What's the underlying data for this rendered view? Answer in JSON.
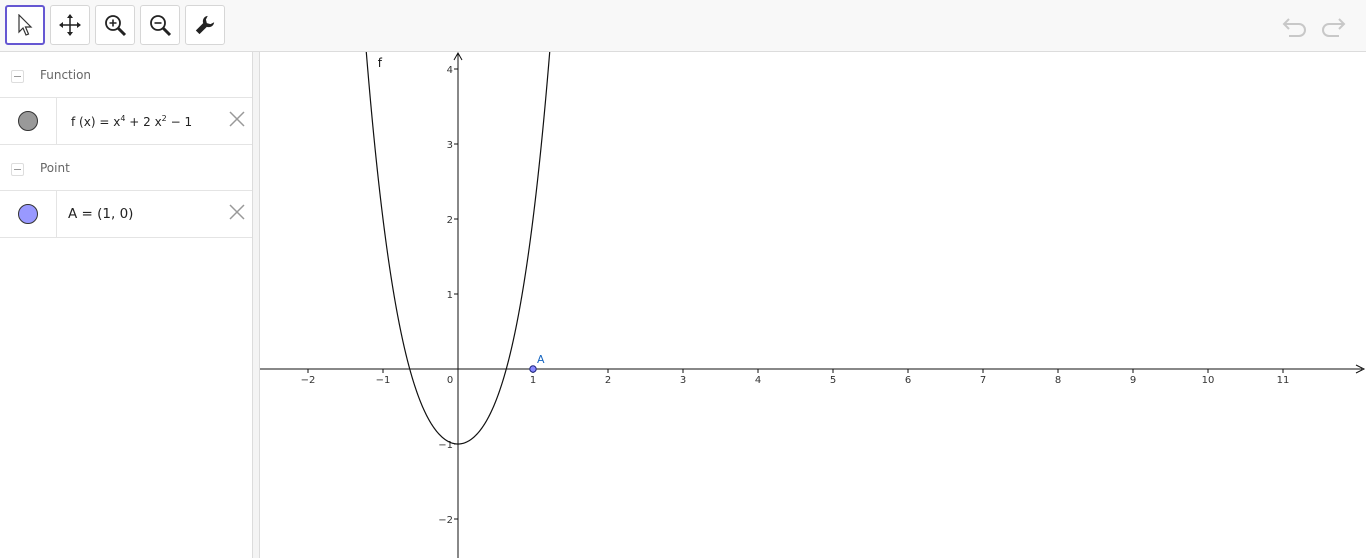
{
  "toolbar": {
    "tools": [
      "move-tool",
      "move-graphics-view-tool",
      "zoom-in-tool",
      "zoom-out-tool",
      "settings-tool"
    ],
    "history": [
      "undo",
      "redo"
    ]
  },
  "algebra": {
    "groups": [
      {
        "label": "Function",
        "formula_name": "f",
        "formula_rhs_x4": "x",
        "exp4": "4",
        "formula_mid": "+ 2",
        "exp2": "2",
        "formula_tail": "− 1",
        "color": "#999999"
      },
      {
        "label": "Point",
        "formula": "A = (1, 0)",
        "color": "#9999ff"
      }
    ]
  },
  "graph": {
    "x_ticks": [
      "−2",
      "−1",
      "0",
      "1",
      "2",
      "3",
      "4",
      "5",
      "6",
      "7",
      "8",
      "9",
      "10",
      "11"
    ],
    "y_ticks": [
      "4",
      "3",
      "2",
      "1",
      "−1",
      "−2"
    ],
    "function_label": "f",
    "point_label": "A",
    "point_color": "#1565c0"
  },
  "chart_data": {
    "type": "line",
    "series": [
      {
        "name": "f",
        "expression": "x^4 + 2x^2 - 1"
      }
    ],
    "points": [
      {
        "name": "A",
        "x": 1,
        "y": 0
      }
    ],
    "xlim": [
      -2.6,
      11.9
    ],
    "ylim": [
      -2.5,
      4.2
    ],
    "grid": false
  }
}
